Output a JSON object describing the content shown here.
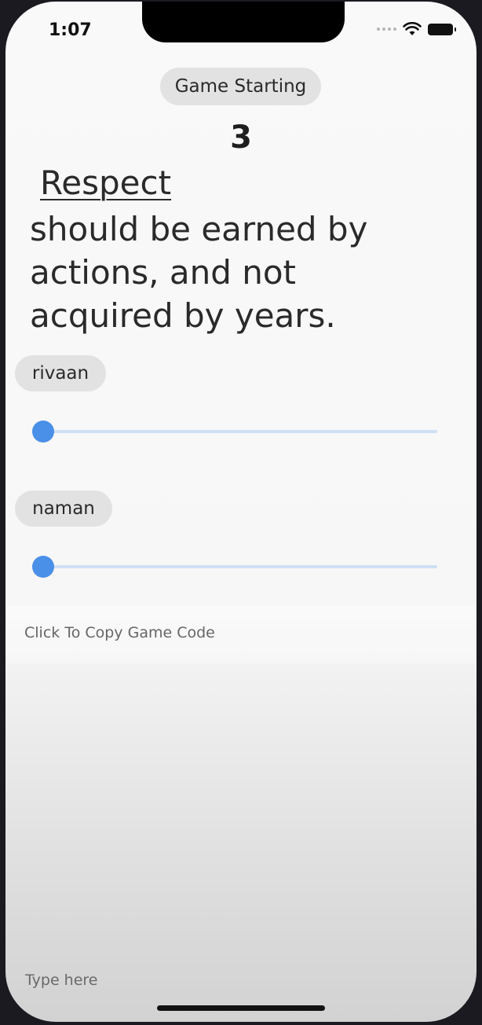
{
  "status_bar": {
    "time": "1:07"
  },
  "game": {
    "status_label": "Game Starting",
    "countdown": "3",
    "quote_first_word": "Respect",
    "quote_rest": "should be earned by actions, and not acquired by years."
  },
  "players": [
    {
      "name": "rivaan",
      "progress": 0
    },
    {
      "name": "naman",
      "progress": 0
    }
  ],
  "copy_code": {
    "label": "Click To Copy Game Code"
  },
  "input": {
    "placeholder": "Type here"
  },
  "colors": {
    "slider_thumb": "#4a8fe8",
    "slider_track": "#cfe0f5",
    "pill_background": "#e2e2e2"
  }
}
